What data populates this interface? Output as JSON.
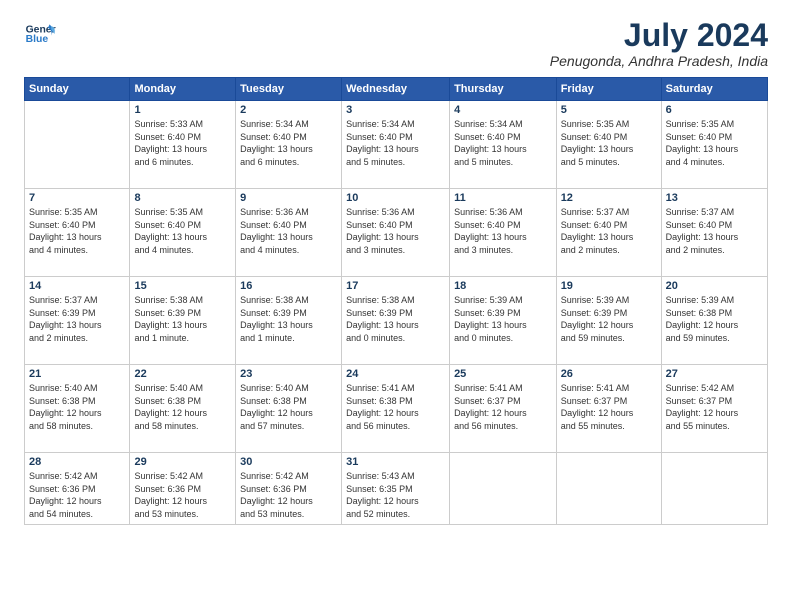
{
  "header": {
    "logo_line1": "General",
    "logo_line2": "Blue",
    "title": "July 2024",
    "location": "Penugonda, Andhra Pradesh, India"
  },
  "weekdays": [
    "Sunday",
    "Monday",
    "Tuesday",
    "Wednesday",
    "Thursday",
    "Friday",
    "Saturday"
  ],
  "weeks": [
    [
      {
        "day": "",
        "info": ""
      },
      {
        "day": "1",
        "info": "Sunrise: 5:33 AM\nSunset: 6:40 PM\nDaylight: 13 hours\nand 6 minutes."
      },
      {
        "day": "2",
        "info": "Sunrise: 5:34 AM\nSunset: 6:40 PM\nDaylight: 13 hours\nand 6 minutes."
      },
      {
        "day": "3",
        "info": "Sunrise: 5:34 AM\nSunset: 6:40 PM\nDaylight: 13 hours\nand 5 minutes."
      },
      {
        "day": "4",
        "info": "Sunrise: 5:34 AM\nSunset: 6:40 PM\nDaylight: 13 hours\nand 5 minutes."
      },
      {
        "day": "5",
        "info": "Sunrise: 5:35 AM\nSunset: 6:40 PM\nDaylight: 13 hours\nand 5 minutes."
      },
      {
        "day": "6",
        "info": "Sunrise: 5:35 AM\nSunset: 6:40 PM\nDaylight: 13 hours\nand 4 minutes."
      }
    ],
    [
      {
        "day": "7",
        "info": "Sunrise: 5:35 AM\nSunset: 6:40 PM\nDaylight: 13 hours\nand 4 minutes."
      },
      {
        "day": "8",
        "info": "Sunrise: 5:35 AM\nSunset: 6:40 PM\nDaylight: 13 hours\nand 4 minutes."
      },
      {
        "day": "9",
        "info": "Sunrise: 5:36 AM\nSunset: 6:40 PM\nDaylight: 13 hours\nand 4 minutes."
      },
      {
        "day": "10",
        "info": "Sunrise: 5:36 AM\nSunset: 6:40 PM\nDaylight: 13 hours\nand 3 minutes."
      },
      {
        "day": "11",
        "info": "Sunrise: 5:36 AM\nSunset: 6:40 PM\nDaylight: 13 hours\nand 3 minutes."
      },
      {
        "day": "12",
        "info": "Sunrise: 5:37 AM\nSunset: 6:40 PM\nDaylight: 13 hours\nand 2 minutes."
      },
      {
        "day": "13",
        "info": "Sunrise: 5:37 AM\nSunset: 6:40 PM\nDaylight: 13 hours\nand 2 minutes."
      }
    ],
    [
      {
        "day": "14",
        "info": "Sunrise: 5:37 AM\nSunset: 6:39 PM\nDaylight: 13 hours\nand 2 minutes."
      },
      {
        "day": "15",
        "info": "Sunrise: 5:38 AM\nSunset: 6:39 PM\nDaylight: 13 hours\nand 1 minute."
      },
      {
        "day": "16",
        "info": "Sunrise: 5:38 AM\nSunset: 6:39 PM\nDaylight: 13 hours\nand 1 minute."
      },
      {
        "day": "17",
        "info": "Sunrise: 5:38 AM\nSunset: 6:39 PM\nDaylight: 13 hours\nand 0 minutes."
      },
      {
        "day": "18",
        "info": "Sunrise: 5:39 AM\nSunset: 6:39 PM\nDaylight: 13 hours\nand 0 minutes."
      },
      {
        "day": "19",
        "info": "Sunrise: 5:39 AM\nSunset: 6:39 PM\nDaylight: 12 hours\nand 59 minutes."
      },
      {
        "day": "20",
        "info": "Sunrise: 5:39 AM\nSunset: 6:38 PM\nDaylight: 12 hours\nand 59 minutes."
      }
    ],
    [
      {
        "day": "21",
        "info": "Sunrise: 5:40 AM\nSunset: 6:38 PM\nDaylight: 12 hours\nand 58 minutes."
      },
      {
        "day": "22",
        "info": "Sunrise: 5:40 AM\nSunset: 6:38 PM\nDaylight: 12 hours\nand 58 minutes."
      },
      {
        "day": "23",
        "info": "Sunrise: 5:40 AM\nSunset: 6:38 PM\nDaylight: 12 hours\nand 57 minutes."
      },
      {
        "day": "24",
        "info": "Sunrise: 5:41 AM\nSunset: 6:38 PM\nDaylight: 12 hours\nand 56 minutes."
      },
      {
        "day": "25",
        "info": "Sunrise: 5:41 AM\nSunset: 6:37 PM\nDaylight: 12 hours\nand 56 minutes."
      },
      {
        "day": "26",
        "info": "Sunrise: 5:41 AM\nSunset: 6:37 PM\nDaylight: 12 hours\nand 55 minutes."
      },
      {
        "day": "27",
        "info": "Sunrise: 5:42 AM\nSunset: 6:37 PM\nDaylight: 12 hours\nand 55 minutes."
      }
    ],
    [
      {
        "day": "28",
        "info": "Sunrise: 5:42 AM\nSunset: 6:36 PM\nDaylight: 12 hours\nand 54 minutes."
      },
      {
        "day": "29",
        "info": "Sunrise: 5:42 AM\nSunset: 6:36 PM\nDaylight: 12 hours\nand 53 minutes."
      },
      {
        "day": "30",
        "info": "Sunrise: 5:42 AM\nSunset: 6:36 PM\nDaylight: 12 hours\nand 53 minutes."
      },
      {
        "day": "31",
        "info": "Sunrise: 5:43 AM\nSunset: 6:35 PM\nDaylight: 12 hours\nand 52 minutes."
      },
      {
        "day": "",
        "info": ""
      },
      {
        "day": "",
        "info": ""
      },
      {
        "day": "",
        "info": ""
      }
    ]
  ]
}
